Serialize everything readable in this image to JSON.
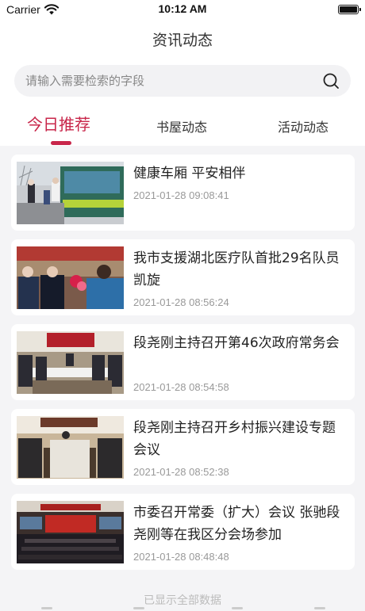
{
  "status_bar": {
    "carrier": "Carrier",
    "time": "10:12 AM"
  },
  "header": {
    "title": "资讯动态"
  },
  "search": {
    "placeholder": "请输入需要检索的字段"
  },
  "tabs": [
    {
      "label": "今日推荐",
      "active": true
    },
    {
      "label": "书屋动态",
      "active": false
    },
    {
      "label": "活动动态",
      "active": false
    }
  ],
  "colors": {
    "accent": "#c8264a",
    "background": "#f4f4f6"
  },
  "news": [
    {
      "title": "健康车厢 平安相伴",
      "time": "2021-01-28 09:08:41"
    },
    {
      "title": "我市支援湖北医疗队首批29名队员凯旋",
      "time": "2021-01-28 08:56:24"
    },
    {
      "title": "段尧刚主持召开第46次政府常务会",
      "time": "2021-01-28 08:54:58"
    },
    {
      "title": "段尧刚主持召开乡村振兴建设专题会议",
      "time": "2021-01-28 08:52:38"
    },
    {
      "title": "市委召开常委（扩大）会议 张驰段尧刚等在我区分会场参加",
      "time": "2021-01-28 08:48:48"
    }
  ],
  "footer": {
    "note": "已显示全部数据"
  }
}
